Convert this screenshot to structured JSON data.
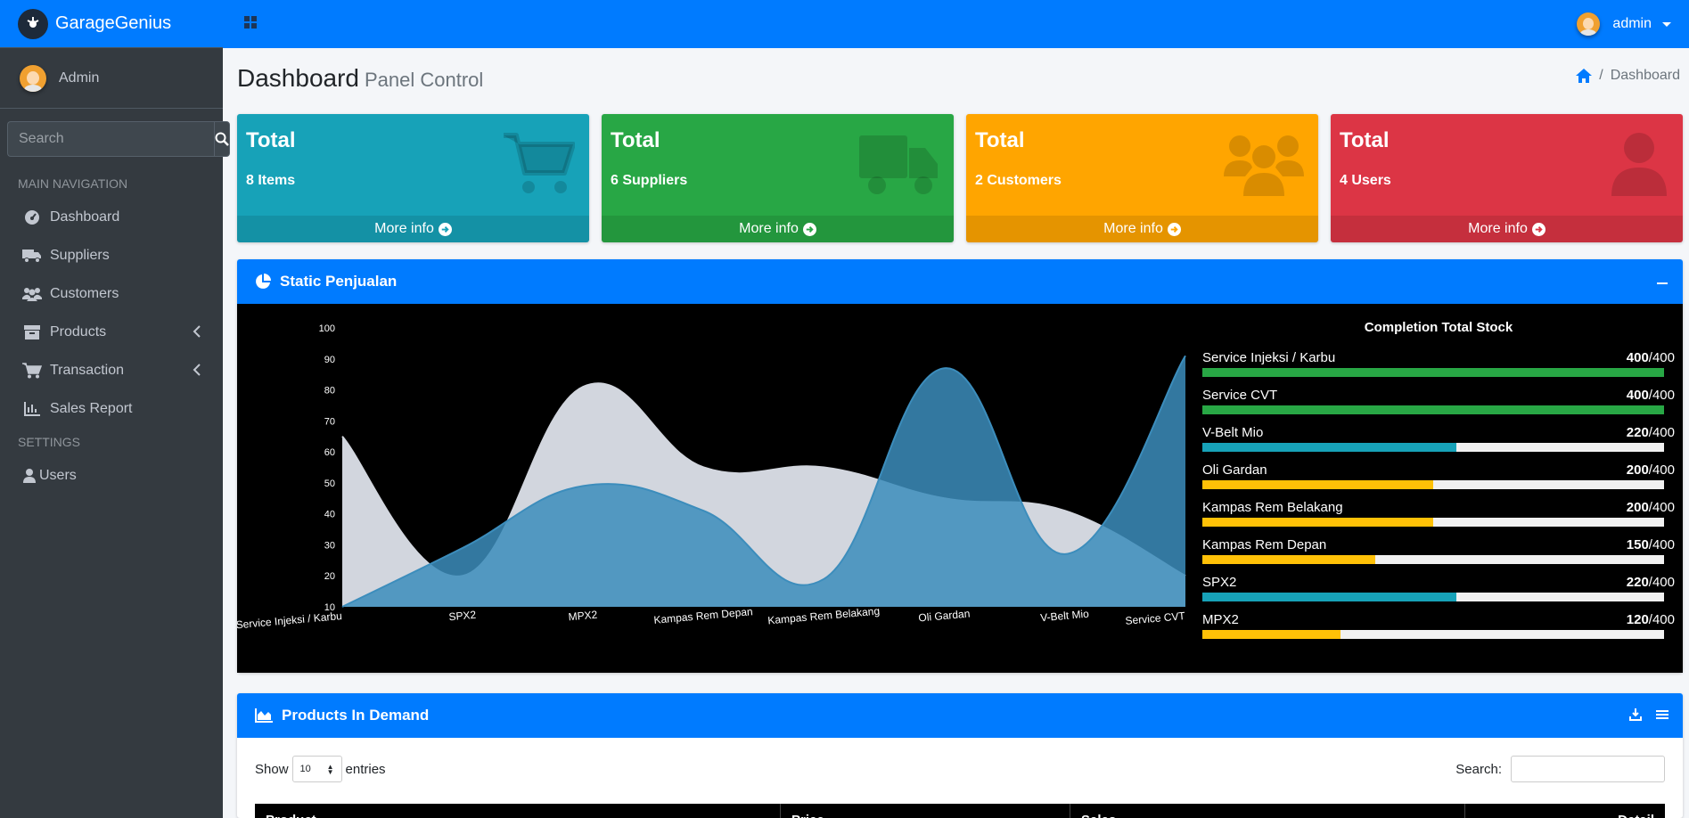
{
  "app": {
    "brand": "GarageGenius"
  },
  "sidebar": {
    "user": "Admin",
    "search_placeholder": "Search",
    "main_nav_header": "MAIN NAVIGATION",
    "settings_header": "SETTINGS",
    "items": [
      {
        "label": "Dashboard",
        "icon": "dashboard-icon"
      },
      {
        "label": "Suppliers",
        "icon": "truck-icon"
      },
      {
        "label": "Customers",
        "icon": "users-icon"
      },
      {
        "label": "Products",
        "icon": "archive-icon"
      },
      {
        "label": "Transaction",
        "icon": "cart-icon"
      },
      {
        "label": "Sales Report",
        "icon": "chart-line-icon"
      }
    ],
    "settings_items": [
      {
        "label": "Users",
        "icon": "user-icon"
      }
    ]
  },
  "topbar": {
    "user": "admin"
  },
  "page": {
    "title": "Dashboard",
    "subtitle": "Panel Control",
    "breadcrumb": "Dashboard"
  },
  "boxes": [
    {
      "title": "Total",
      "sub": "8 Items",
      "footer": "More info",
      "icon": "cart-icon",
      "color": "#17a2b8"
    },
    {
      "title": "Total",
      "sub": "6 Suppliers",
      "footer": "More info",
      "icon": "truck-icon",
      "color": "#28a745"
    },
    {
      "title": "Total",
      "sub": "2 Customers",
      "footer": "More info",
      "icon": "users-icon",
      "color": "#ffa500"
    },
    {
      "title": "Total",
      "sub": "4 Users",
      "footer": "More info",
      "icon": "user-icon",
      "color": "#dc3545"
    }
  ],
  "chart_card": {
    "title": "Static Penjualan"
  },
  "chart_data": {
    "type": "area",
    "categories": [
      "Service Injeksi / Karbu",
      "SPX2",
      "MPX2",
      "Kampas Rem Depan",
      "Kampas Rem Belakang",
      "Oli Gardan",
      "V-Belt Mio",
      "Service CVT"
    ],
    "ylim": [
      10,
      100
    ],
    "yticks": [
      10,
      20,
      30,
      40,
      50,
      60,
      70,
      80,
      90,
      100
    ],
    "grid": false,
    "series": [
      {
        "values": [
          65,
          20,
          81,
          55,
          55,
          45,
          41,
          20
        ],
        "color": "#d2d6de"
      },
      {
        "values": [
          10,
          29,
          49,
          41,
          19,
          87,
          27,
          91
        ],
        "color": "#3c8dbc"
      }
    ]
  },
  "stock": {
    "title": "Completion Total Stock",
    "items": [
      {
        "label": "Service Injeksi / Karbu",
        "value": "400",
        "max": "/400",
        "fraction": 1.0,
        "color": "#28a745"
      },
      {
        "label": "Service CVT",
        "value": "400",
        "max": "/400",
        "fraction": 1.0,
        "color": "#28a745"
      },
      {
        "label": "V-Belt Mio",
        "value": "220",
        "max": "/400",
        "fraction": 0.55,
        "color": "#17a2b8"
      },
      {
        "label": "Oli Gardan",
        "value": "200",
        "max": "/400",
        "fraction": 0.5,
        "color": "#ffc107"
      },
      {
        "label": "Kampas Rem Belakang",
        "value": "200",
        "max": "/400",
        "fraction": 0.5,
        "color": "#ffc107"
      },
      {
        "label": "Kampas Rem Depan",
        "value": "150",
        "max": "/400",
        "fraction": 0.375,
        "color": "#ffc107"
      },
      {
        "label": "SPX2",
        "value": "220",
        "max": "/400",
        "fraction": 0.55,
        "color": "#17a2b8"
      },
      {
        "label": "MPX2",
        "value": "120",
        "max": "/400",
        "fraction": 0.3,
        "color": "#ffc107"
      }
    ]
  },
  "demand": {
    "title": "Products In Demand",
    "show": "Show",
    "length": "10",
    "entries": "entries",
    "search": "Search:",
    "columns": [
      "Product",
      "Price",
      "Sales",
      "Detail"
    ]
  }
}
